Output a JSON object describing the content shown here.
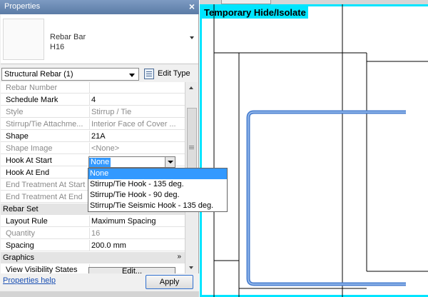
{
  "properties_panel": {
    "title": "Properties",
    "close_glyph": "×",
    "type_selector": {
      "line1": "Rebar Bar",
      "line2": "H16"
    },
    "filter": {
      "value": "Structural Rebar (1)"
    },
    "edit_type_label": "Edit Type",
    "rows": [
      {
        "name": "Rebar Number",
        "value": "",
        "dim": true
      },
      {
        "name": "Schedule Mark",
        "value": "4",
        "dim": false
      },
      {
        "name": "Style",
        "value": "Stirrup / Tie",
        "dim": true
      },
      {
        "name": "Stirrup/Tie Attachme...",
        "value": "Interior Face of Cover ...",
        "dim": true
      },
      {
        "name": "Shape",
        "value": "21A",
        "dim": false
      },
      {
        "name": "Shape Image",
        "value": "<None>",
        "dim": true
      },
      {
        "name": "Hook At Start",
        "value": "",
        "dim": false
      },
      {
        "name": "Hook At End",
        "value": "",
        "dim": false
      },
      {
        "name": "End Treatment At Start",
        "value": "",
        "dim": true
      },
      {
        "name": "End Treatment At End",
        "value": "",
        "dim": true
      },
      {
        "name": "Rebar Set",
        "value": "",
        "group": true
      },
      {
        "name": "Layout Rule",
        "value": "Maximum Spacing",
        "dim": false
      },
      {
        "name": "Quantity",
        "value": "16",
        "dim": true
      },
      {
        "name": "Spacing",
        "value": "200.0 mm",
        "dim": false
      },
      {
        "name": "Graphics",
        "value": "",
        "group": true
      },
      {
        "name": "View Visibility States",
        "value": "",
        "dim": false
      }
    ],
    "graphics_chevron": "»",
    "hook_at_start_value": "None",
    "dropdown_options": [
      "None",
      "Stirrup/Tie Hook - 135 deg.",
      "Stirrup/Tie Hook - 90 deg.",
      "Stirrup/Tie Seismic Hook - 135 deg."
    ],
    "visibility_edit_label": "Edit...",
    "help_link": "Properties help",
    "apply_label": "Apply"
  },
  "view": {
    "mode_label": "Temporary Hide/Isolate",
    "highlight_color": "#00e5ff",
    "rebar_color": "#4a7fd0"
  }
}
